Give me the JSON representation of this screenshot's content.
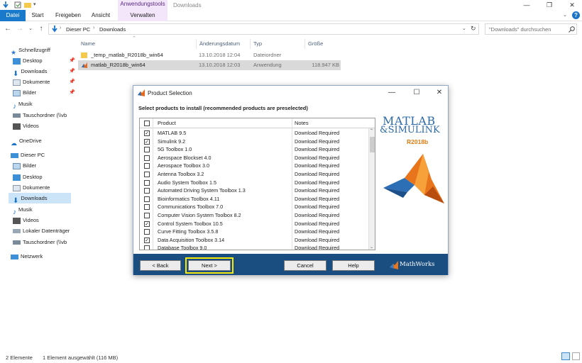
{
  "ribbon": {
    "context_group": "Anwendungstools",
    "window_title": "Downloads",
    "tabs": [
      "Datei",
      "Start",
      "Freigeben",
      "Ansicht",
      "Verwalten"
    ]
  },
  "address": {
    "path": [
      "Dieser PC",
      "Downloads"
    ],
    "search_placeholder": "\"Downloads\" durchsuchen"
  },
  "nav": {
    "quick_access": "Schnellzugriff",
    "quick_items": [
      {
        "label": "Desktop",
        "pinned": true
      },
      {
        "label": "Downloads",
        "pinned": true
      },
      {
        "label": "Dokumente",
        "pinned": true
      },
      {
        "label": "Bilder",
        "pinned": true
      },
      {
        "label": "Musik",
        "pinned": false
      },
      {
        "label": "Tauschordner (\\\\vb",
        "pinned": false
      },
      {
        "label": "Videos",
        "pinned": false
      }
    ],
    "onedrive": "OneDrive",
    "this_pc": "Dieser PC",
    "pc_items": [
      "Bilder",
      "Desktop",
      "Dokumente",
      "Downloads",
      "Musik",
      "Videos",
      "Lokaler Datenträger",
      "Tauschordner (\\\\vb"
    ],
    "network": "Netzwerk"
  },
  "files": {
    "columns": [
      "Name",
      "Änderungsdatum",
      "Typ",
      "Größe"
    ],
    "rows": [
      {
        "name": "_temp_matlab_R2018b_win64",
        "date": "13.10.2018 12:04",
        "type": "Dateiordner",
        "size": ""
      },
      {
        "name": "matlab_R2018b_win64",
        "date": "13.10.2018 12:03",
        "type": "Anwendung",
        "size": "118.947 KB"
      }
    ]
  },
  "status": {
    "count": "2 Elemente",
    "selection": "1 Element ausgewählt (116 MB)"
  },
  "dialog": {
    "title": "Product Selection",
    "heading": "Select products to install (recommended products are preselected)",
    "col_product": "Product",
    "col_notes": "Notes",
    "products": [
      {
        "name": "MATLAB 9.5",
        "note": "Download Required",
        "checked": true
      },
      {
        "name": "Simulink 9.2",
        "note": "Download Required",
        "checked": true
      },
      {
        "name": "5G Toolbox 1.0",
        "note": "Download Required",
        "checked": false
      },
      {
        "name": "Aerospace Blockset 4.0",
        "note": "Download Required",
        "checked": false
      },
      {
        "name": "Aerospace Toolbox 3.0",
        "note": "Download Required",
        "checked": false
      },
      {
        "name": "Antenna Toolbox 3.2",
        "note": "Download Required",
        "checked": false
      },
      {
        "name": "Audio System Toolbox 1.5",
        "note": "Download Required",
        "checked": false
      },
      {
        "name": "Automated Driving System Toolbox 1.3",
        "note": "Download Required",
        "checked": false
      },
      {
        "name": "Bioinformatics Toolbox 4.11",
        "note": "Download Required",
        "checked": false
      },
      {
        "name": "Communications Toolbox 7.0",
        "note": "Download Required",
        "checked": false
      },
      {
        "name": "Computer Vision System Toolbox 8.2",
        "note": "Download Required",
        "checked": false
      },
      {
        "name": "Control System Toolbox 10.5",
        "note": "Download Required",
        "checked": true
      },
      {
        "name": "Curve Fitting Toolbox 3.5.8",
        "note": "Download Required",
        "checked": false
      },
      {
        "name": "Data Acquisition Toolbox 3.14",
        "note": "Download Required",
        "checked": true
      },
      {
        "name": "Database Toolbox 9.0",
        "note": "Download Required",
        "checked": false
      }
    ],
    "logo_matlab": "MATLAB",
    "logo_simulink": "&SIMULINK",
    "release": "R2018b",
    "buttons": {
      "back": "< Back",
      "next": "Next >",
      "cancel": "Cancel",
      "help": "Help"
    },
    "mathworks": "MathWorks"
  },
  "colors": {
    "accent": "#1979ca",
    "dialog_footer": "#1b4e80",
    "focus": "#f7ea0a"
  }
}
